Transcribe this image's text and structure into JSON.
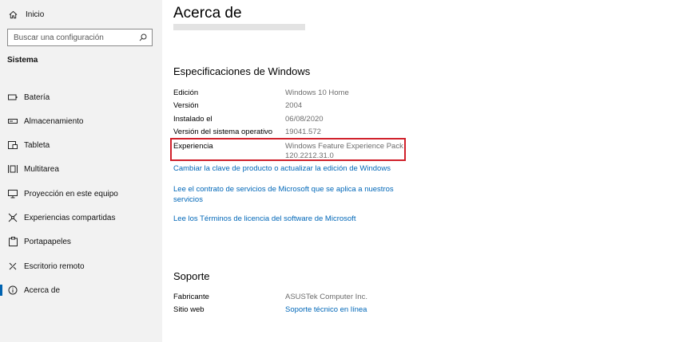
{
  "sidebar": {
    "home_label": "Inicio",
    "search_placeholder": "Buscar una configuración",
    "section_title": "Sistema",
    "items": [
      {
        "label": "Batería",
        "icon": "battery-icon"
      },
      {
        "label": "Almacenamiento",
        "icon": "storage-icon"
      },
      {
        "label": "Tableta",
        "icon": "tablet-icon"
      },
      {
        "label": "Multitarea",
        "icon": "multitasking-icon"
      },
      {
        "label": "Proyección en este equipo",
        "icon": "projection-icon"
      },
      {
        "label": "Experiencias compartidas",
        "icon": "shared-experiences-icon"
      },
      {
        "label": "Portapapeles",
        "icon": "clipboard-icon"
      },
      {
        "label": "Escritorio remoto",
        "icon": "remote-desktop-icon"
      },
      {
        "label": "Acerca de",
        "icon": "info-icon",
        "selected": true
      }
    ]
  },
  "main": {
    "title": "Acerca de",
    "windows_specs": {
      "heading": "Especificaciones de Windows",
      "rows": [
        {
          "key": "Edición",
          "value": "Windows 10 Home"
        },
        {
          "key": "Versión",
          "value": "2004"
        },
        {
          "key": "Instalado el",
          "value": "06/08/2020"
        },
        {
          "key": "Versión del sistema operativo",
          "value": "19041.572"
        },
        {
          "key": "Experiencia",
          "value": "Windows Feature Experience Pack 120.2212.31.0"
        }
      ],
      "links": [
        "Cambiar la clave de producto o actualizar la edición de Windows",
        "Lee el contrato de servicios de Microsoft que se aplica a nuestros servicios",
        "Lee los Términos de licencia del software de Microsoft"
      ]
    },
    "support": {
      "heading": "Soporte",
      "rows": [
        {
          "key": "Fabricante",
          "value": "ASUSTek Computer Inc."
        },
        {
          "key": "Sitio web",
          "value": "Soporte técnico en línea"
        }
      ]
    }
  },
  "colors": {
    "accent": "#0067b8",
    "highlight_border": "#d0202a",
    "sidebar_bg": "#f2f2f2"
  }
}
